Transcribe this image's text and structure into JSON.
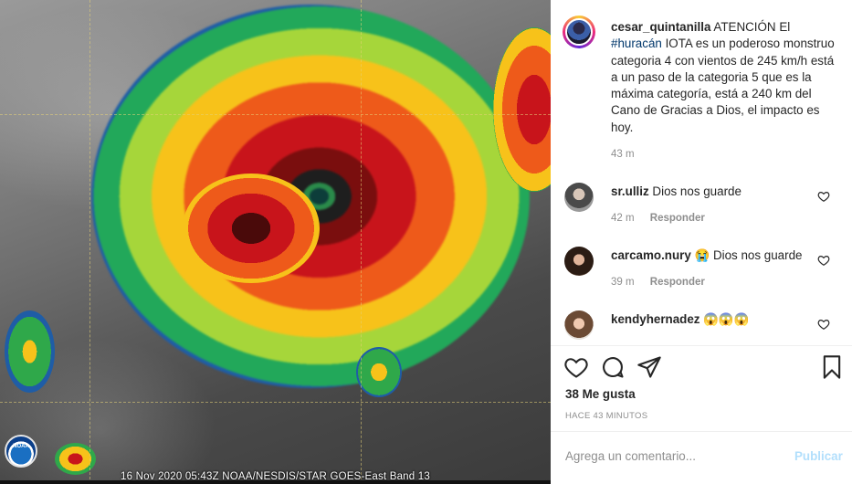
{
  "media": {
    "caption": "16 Nov 2020 05:43Z NOAA/NESDIS/STAR GOES-East Band 13",
    "logo_text": "NOAA"
  },
  "post": {
    "username": "cesar_quintanilla",
    "caption_start": "ATENCIÓN",
    "caption_pre": "El",
    "hashtag": "#huracán",
    "caption_rest": "IOTA es un poderoso monstruo categoria 4 con vientos de 245 km/h está a un paso de la categoria 5 que es la máxima categoría, está a 240 km del Cano de Gracias a Dios, el impacto es hoy.",
    "time": "43 m"
  },
  "comments": [
    {
      "username": "sr.ulliz",
      "text": "Dios nos guarde",
      "time": "42 m",
      "reply": "Responder"
    },
    {
      "username": "carcamo.nury",
      "text": "😭 Dios nos guarde",
      "time": "39 m",
      "reply": "Responder"
    },
    {
      "username": "kendyhernadez",
      "text": "😱😱😱",
      "time": "",
      "reply": ""
    }
  ],
  "footer": {
    "likes": "38 Me gusta",
    "ago": "HACE 43 MINUTOS",
    "comment_placeholder": "Agrega un comentario...",
    "publish": "Publicar"
  },
  "icons": {
    "like": "heart-icon",
    "comment": "comment-icon",
    "share": "share-icon",
    "save": "bookmark-icon"
  },
  "colors": {
    "link": "#00376b",
    "muted": "#8e8e8e",
    "publish_disabled": "#b2dffc"
  }
}
